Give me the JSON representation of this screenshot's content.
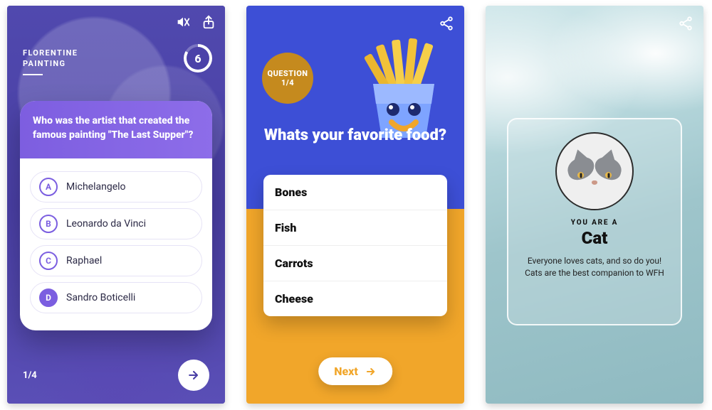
{
  "phone1": {
    "category_line1": "FLORENTINE",
    "category_line2": "PAINTING",
    "timer": "6",
    "question": "Who was the artist that created the famous painting \"The Last Supper\"?",
    "options": [
      {
        "letter": "A",
        "label": "Michelangelo"
      },
      {
        "letter": "B",
        "label": "Leonardo da Vinci"
      },
      {
        "letter": "C",
        "label": "Raphael"
      },
      {
        "letter": "D",
        "label": "Sandro Boticelli"
      }
    ],
    "progress": "1/4"
  },
  "phone2": {
    "badge_label": "QUESTION",
    "badge_progress": "1/4",
    "question": "Whats your favorite food?",
    "options": [
      "Bones",
      "Fish",
      "Carrots",
      "Cheese"
    ],
    "next_label": "Next"
  },
  "phone3": {
    "subheading": "YOU ARE A",
    "result_name": "Cat",
    "desc_line1": "Everyone loves cats, and so do you!",
    "desc_line2": "Cats are the best companion to WFH"
  }
}
